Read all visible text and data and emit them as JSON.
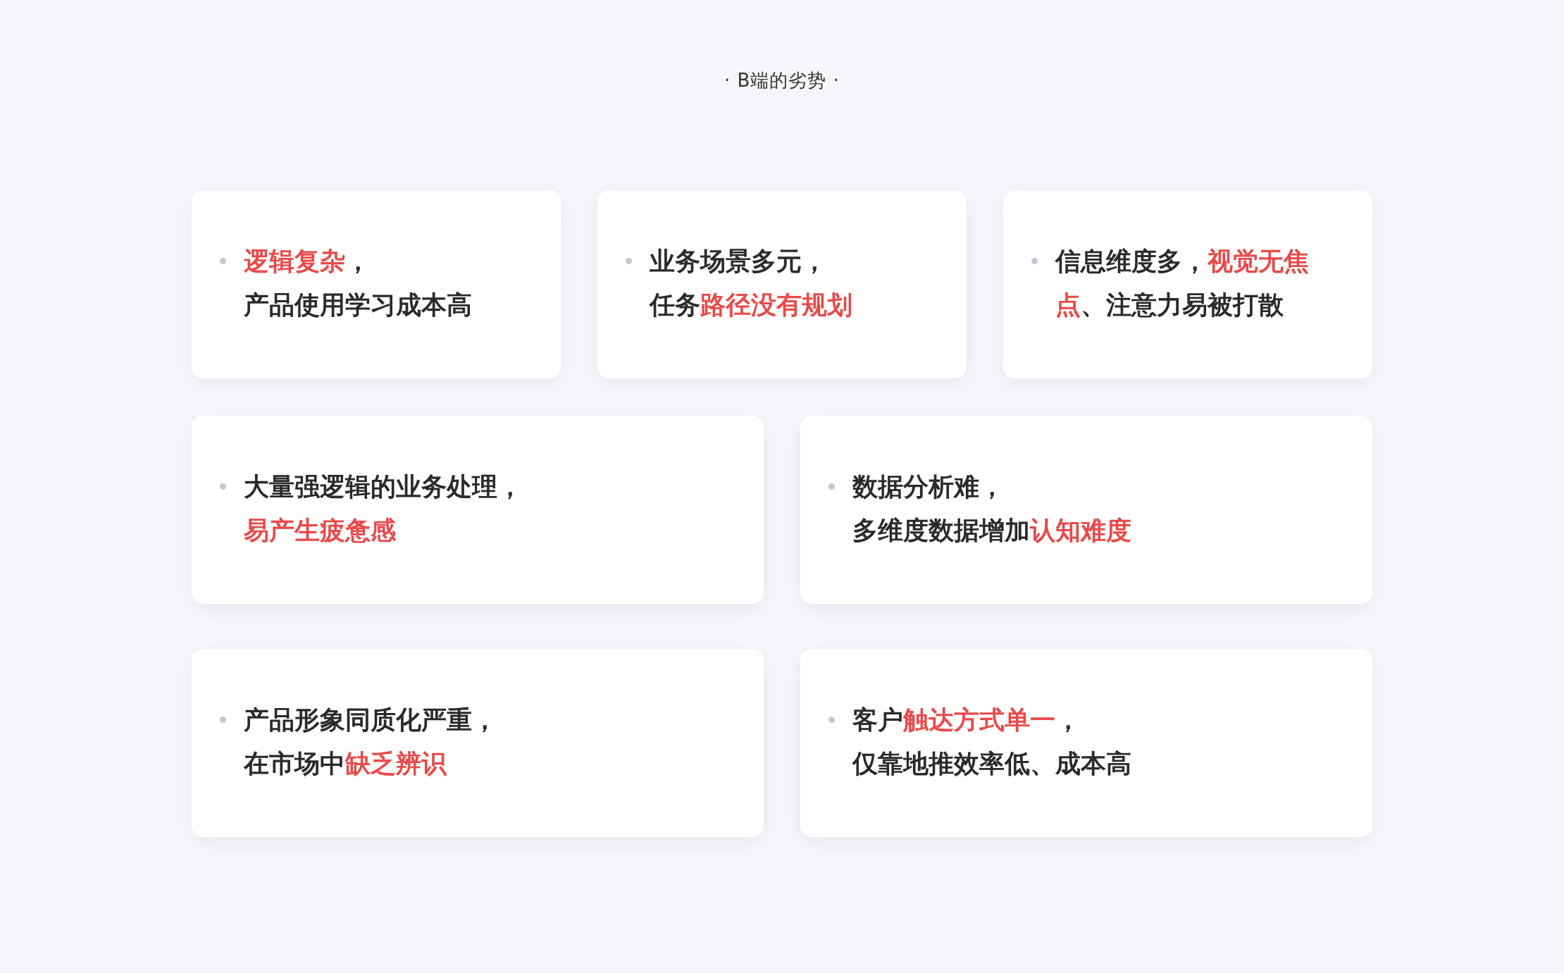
{
  "title": "· B端的劣势 ·",
  "rows": [
    {
      "cards": [
        {
          "lines": [
            [
              {
                "text": "逻辑复杂",
                "highlight": true
              },
              {
                "text": "，",
                "highlight": false
              }
            ],
            [
              {
                "text": "产品使用学习成本高",
                "highlight": false
              }
            ]
          ]
        },
        {
          "lines": [
            [
              {
                "text": "业务场景多元，",
                "highlight": false
              }
            ],
            [
              {
                "text": "任务",
                "highlight": false
              },
              {
                "text": "路径没有规划",
                "highlight": true
              }
            ]
          ]
        },
        {
          "lines": [
            [
              {
                "text": "信息维度多，",
                "highlight": false
              },
              {
                "text": "视觉无焦点",
                "highlight": true
              },
              {
                "text": "、注意力易被打散",
                "highlight": false
              }
            ]
          ]
        }
      ]
    },
    {
      "cards": [
        {
          "lines": [
            [
              {
                "text": "大量强逻辑的业务处理，",
                "highlight": false
              }
            ],
            [
              {
                "text": "易产生疲惫感",
                "highlight": true
              }
            ]
          ]
        },
        {
          "lines": [
            [
              {
                "text": "数据分析难，",
                "highlight": false
              }
            ],
            [
              {
                "text": "多维度数据增加",
                "highlight": false
              },
              {
                "text": "认知难度",
                "highlight": true
              }
            ]
          ]
        }
      ]
    },
    {
      "cards": [
        {
          "lines": [
            [
              {
                "text": "产品形象同质化严重，",
                "highlight": false
              }
            ],
            [
              {
                "text": "在市场中",
                "highlight": false
              },
              {
                "text": "缺乏辨识",
                "highlight": true
              }
            ]
          ]
        },
        {
          "lines": [
            [
              {
                "text": "客户",
                "highlight": false
              },
              {
                "text": "触达方式单一",
                "highlight": true
              },
              {
                "text": "，",
                "highlight": false
              }
            ],
            [
              {
                "text": "仅靠地推效率低、成本高",
                "highlight": false
              }
            ]
          ]
        }
      ]
    }
  ]
}
